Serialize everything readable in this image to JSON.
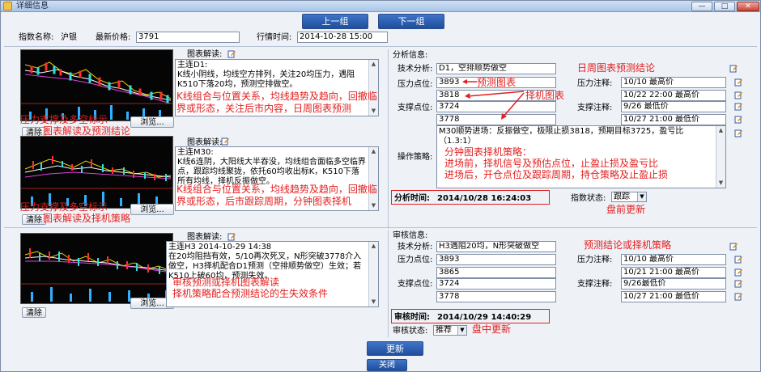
{
  "window": {
    "title": "详细信息",
    "minimize": "—",
    "maximize": "□",
    "close": "✕"
  },
  "nav": {
    "prev": "上一组",
    "next": "下一组"
  },
  "header": {
    "index_label": "指数名称:",
    "index_value": "沪银",
    "price_label": "最新价格:",
    "price_value": "3791",
    "time_label": "行情时间:",
    "time_value": "2014-10-28 15:00"
  },
  "top_section": {
    "chart_commentary_label_1": "图表解读:",
    "commentary_1": "主连D1:\nK线小阴线，均线空方排列，关注20均压力，遇阻K510下落20均，预测空排做空。",
    "commentary_1_red": "K线组合与位置关系，均线趋势及趋向，回撤临界或形态，关注后市内容，日周图表预测",
    "thumb1_red": "压力支撑及多空标示",
    "thumb1_clear": "清除",
    "thumb1_caption": "图表解读及预测结论",
    "browse": "浏览...",
    "chart_commentary_label_2": "图表解读:",
    "commentary_2": "主连M30:\nK线6连阴，大阳线大半吞没，均线组合面临多空临界点，跟踪均线聚拢，依托60均收出标K，K510下落所有均线，择机反振做空。",
    "commentary_2_red": "K线组合与位置关系，均线趋势及趋向，回撤临界或形态，后市跟踪周期，分钟图表择机",
    "thumb2_red": "压力支撑及多空标示",
    "thumb2_clear": "清除",
    "thumb2_caption": "图表解读及择机策略"
  },
  "analysis": {
    "title": "分析信息:",
    "tech_label": "技术分析:",
    "tech_value": "D1，空排顺势做空",
    "tech_red": "日周图表预测结论",
    "resist_label": "压力点位:",
    "resist_1": "3893",
    "resist_2": "3818",
    "resist_red": "预测图表",
    "pressure_note_label": "压力注释:",
    "pressure_note_1": "10/10 最高价",
    "pressure_note_2": "10/22 22:00 最高价",
    "support_label": "支撑点位:",
    "support_1": "3724",
    "support_2": "3778",
    "support_red": "择机图表",
    "support_note_label": "支撑注释:",
    "support_note_1": "9/26 最低价",
    "support_note_2": "10/27 21:00 最低价",
    "strategy_label": "操作策略:",
    "strategy_text": "M30顺势进场：反振做空，极限止损3818，预期目标3725，盈亏比（1.3:1）",
    "strategy_red_1": "分钟图表择机策略：",
    "strategy_red_2": "进场前，择机信号及预估点位，止盈止损及盈亏比",
    "strategy_red_3": "进场后，开仓点位及跟踪周期，持仓策略及止盈止损",
    "time_label": "分析时间:",
    "time_value": "2014/10/28 16:24:03",
    "status_label": "指数状态:",
    "status_value": "跟踪",
    "status_red": "盘前更新"
  },
  "bottom_section": {
    "chart_commentary_label": "图表解读:",
    "commentary": "主连H3 2014-10-29 14:38\n在20均阻挡有效，5/10再次死叉，N形突破3778介入做空，H3择机配合D1预测（空排顺势做空）生效；若K510上破60均，预测失效。",
    "commentary_red_1": "审核预测或择机图表解读",
    "commentary_red_2": "择机策略配合预测结论的生失效条件",
    "clear": "清除",
    "browse": "浏览..."
  },
  "review": {
    "title": "审核信息:",
    "tech_label": "技术分析:",
    "tech_value": "H3遇阻20均，N形突破做空",
    "tech_red": "预测结论或择机策略",
    "resist_label": "压力点位:",
    "resist_1": "3893",
    "resist_2": "3865",
    "pressure_note_label": "压力注释:",
    "pressure_note_1": "10/10 最高价",
    "pressure_note_2": "10/21 21:00 最高价",
    "support_label": "支撑点位:",
    "support_1": "3724",
    "support_2": "3778",
    "support_note_label": "支撑注释:",
    "support_note_1": "9/26最低价",
    "support_note_2": "10/27 21:00 最低价",
    "time_label": "审核时间:",
    "time_value": "2014/10/29 14:40:29",
    "status_label": "审核状态:",
    "status_value": "推荐",
    "status_red": "盘中更新"
  },
  "footer": {
    "update": "更新",
    "close": "关闭"
  }
}
